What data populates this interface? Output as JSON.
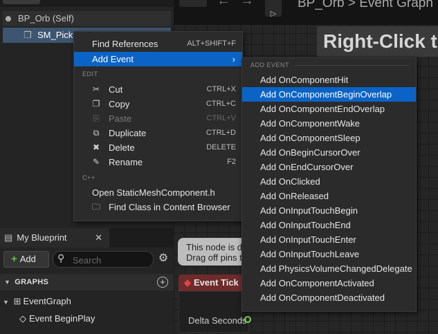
{
  "components": {
    "self_label": "BP_Orb (Self)",
    "selected_label": "SM_Pick"
  },
  "my_blueprint": {
    "tab_label": "My Blueprint",
    "add_label": "Add",
    "search_placeholder": "Search",
    "graphs_header": "GRAPHS",
    "tree": [
      "EventGraph",
      "Event BeginPlay"
    ]
  },
  "graph": {
    "breadcrumb": "BP_Orb  >  Event Graph",
    "hint_title": "Right-Click to",
    "comment_lines": [
      "This node is d",
      "Drag off pins t"
    ],
    "event_tick": "Event Tick",
    "delta_seconds": "Delta Seconds"
  },
  "context_menu": {
    "find_references": {
      "label": "Find References",
      "shortcut": "ALT+SHIFT+F"
    },
    "add_event": {
      "label": "Add Event"
    },
    "edit_section": "EDIT",
    "edit_items": [
      {
        "label": "Cut",
        "shortcut": "CTRL+X",
        "icon": "cut-icon",
        "disabled": false
      },
      {
        "label": "Copy",
        "shortcut": "CTRL+C",
        "icon": "copy-icon",
        "disabled": false
      },
      {
        "label": "Paste",
        "shortcut": "CTRL+V",
        "icon": "paste-icon",
        "disabled": true
      },
      {
        "label": "Duplicate",
        "shortcut": "CTRL+D",
        "icon": "duplicate-icon",
        "disabled": false
      },
      {
        "label": "Delete",
        "shortcut": "DELETE",
        "icon": "delete-icon",
        "disabled": false
      },
      {
        "label": "Rename",
        "shortcut": "F2",
        "icon": "rename-icon",
        "disabled": false
      }
    ],
    "cpp_section": "C++",
    "open_header": "Open StaticMeshComponent.h",
    "find_class": "Find Class in Content Browser"
  },
  "submenu": {
    "section": "ADD EVENT",
    "highlighted_index": 1,
    "items": [
      "Add OnComponentHit",
      "Add OnComponentBeginOverlap",
      "Add OnComponentEndOverlap",
      "Add OnComponentWake",
      "Add OnComponentSleep",
      "Add OnBeginCursorOver",
      "Add OnEndCursorOver",
      "Add OnClicked",
      "Add OnReleased",
      "Add OnInputTouchBegin",
      "Add OnInputTouchEnd",
      "Add OnInputTouchEnter",
      "Add OnInputTouchLeave",
      "Add PhysicsVolumeChangedDelegate",
      "Add OnComponentActivated",
      "Add OnComponentDeactivated"
    ]
  },
  "colors": {
    "highlight": "#0b63c5",
    "menu_bg": "#2b2b2b",
    "event_node": "#6e2b2b",
    "exec_pin": "#7ed957"
  }
}
